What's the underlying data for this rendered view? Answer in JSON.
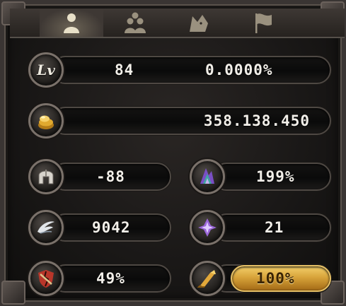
{
  "tabs": [
    {
      "icon": "character-silhouette-icon",
      "active": true
    },
    {
      "icon": "party-silhouette-icon",
      "active": false
    },
    {
      "icon": "wolf-head-icon",
      "active": false
    },
    {
      "icon": "flag-icon",
      "active": false
    }
  ],
  "level": {
    "icon_label": "Lv",
    "value": "84",
    "exp_percent": "0.0000%"
  },
  "gold": {
    "icon": "gold-coin-pile-icon",
    "value": "358.138.450"
  },
  "stats": [
    {
      "icon": "helmet-icon",
      "value": "-88"
    },
    {
      "icon": "magic-flame-icon",
      "value": "199%"
    },
    {
      "icon": "wing-icon",
      "value": "9042"
    },
    {
      "icon": "purple-crystal-icon",
      "value": "21"
    },
    {
      "icon": "cracked-shield-icon",
      "value": "49%"
    },
    {
      "icon": "golden-scroll-icon",
      "value": "100%",
      "highlighted": true
    }
  ],
  "colors": {
    "highlight": "#d8a43a",
    "text": "#f2efe9",
    "frame": "#4e4843"
  }
}
